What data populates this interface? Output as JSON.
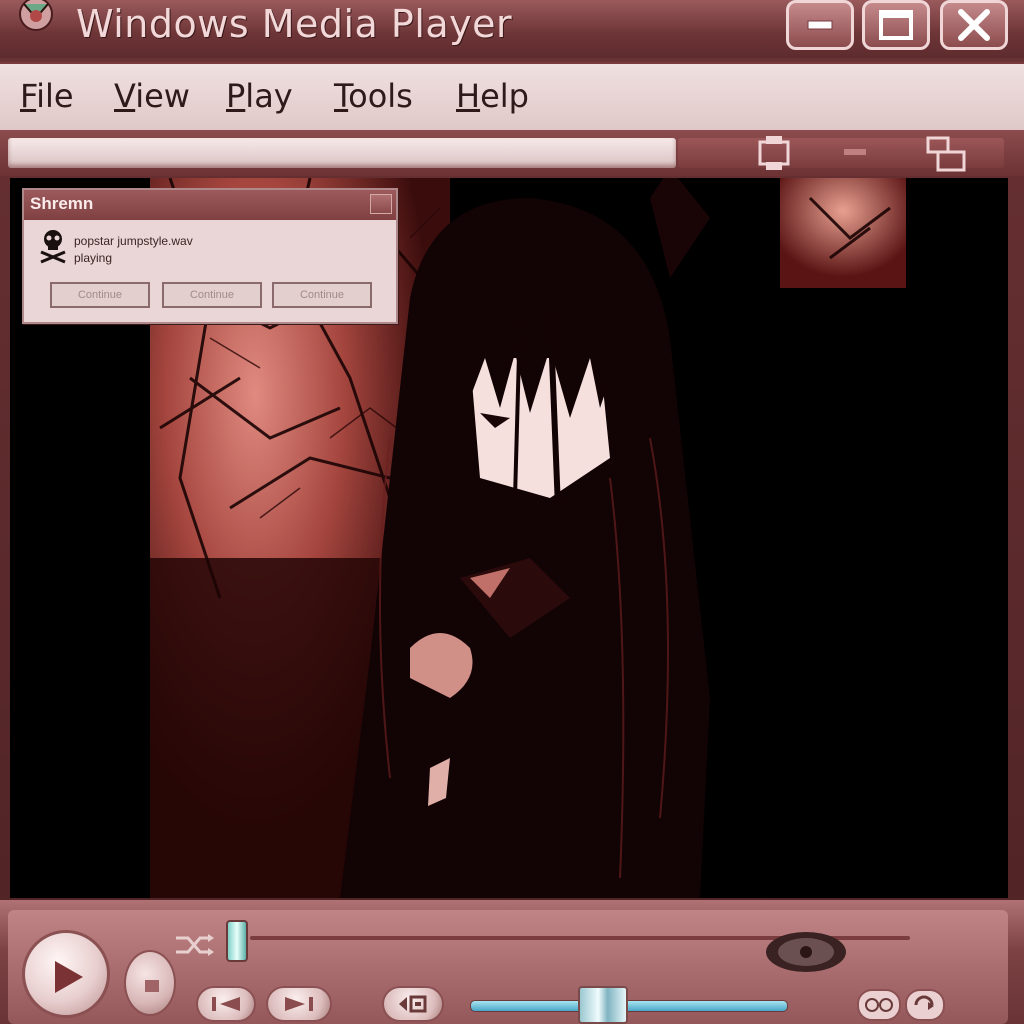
{
  "window": {
    "title": "Windows Media Player"
  },
  "menu": {
    "items": [
      {
        "first": "F",
        "rest": "ile"
      },
      {
        "first": "V",
        "rest": "iew"
      },
      {
        "first": "P",
        "rest": "lay"
      },
      {
        "first": "T",
        "rest": "ools"
      },
      {
        "first": "H",
        "rest": "elp"
      }
    ]
  },
  "dialog": {
    "title": "Shremn",
    "filename": "popstar jumpstyle.wav",
    "status": "playing",
    "buttons": [
      "Continue",
      "Continue",
      "Continue"
    ]
  },
  "player": {
    "seek_progress": 0.0,
    "volume_level": 0.42
  },
  "colors": {
    "frame": "#6a3234",
    "menu_bg": "#f0e0e0",
    "accent_teal": "#7fd0c8",
    "accent_blue": "#4aa6c8"
  },
  "icons": {
    "app": "wmp-logo-icon",
    "skull": "skull-icon",
    "play": "play-icon",
    "stop": "stop-icon",
    "prev": "previous-icon",
    "next": "next-icon",
    "mute": "mute-icon",
    "volume": "volume-icon"
  }
}
